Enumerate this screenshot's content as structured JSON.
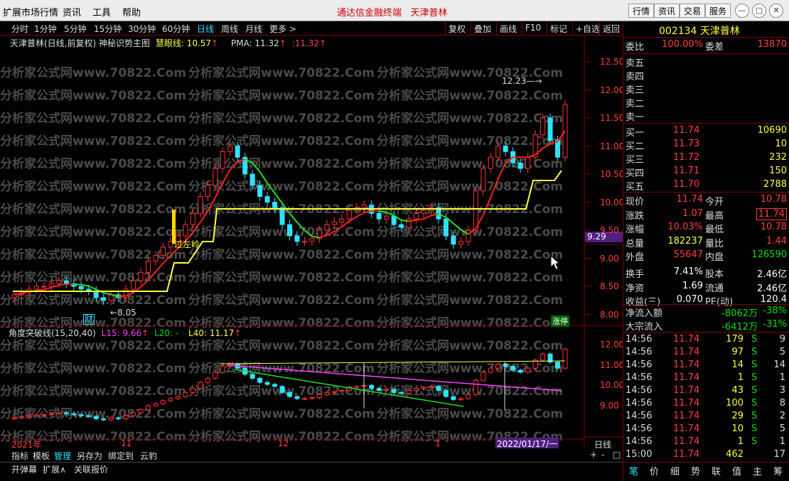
{
  "menubar": {
    "items": [
      "扩展市场行情",
      "资讯",
      "工具",
      "帮助"
    ],
    "brand": "通达信金融终端",
    "stock_title": "天津普林",
    "right_buttons": [
      "行情",
      "资讯",
      "交易",
      "服务"
    ],
    "window_icons": [
      "minimize-icon",
      "restore-icon",
      "close-icon"
    ]
  },
  "periods": {
    "items": [
      "分时",
      "1分钟",
      "5分钟",
      "15分钟",
      "30分钟",
      "60分钟",
      "日线",
      "周线",
      "月线",
      "更多 >"
    ],
    "active": "日线",
    "tools": [
      "复权",
      "叠加",
      "画线",
      "F10",
      "标记",
      "+自选",
      "返回"
    ]
  },
  "chart": {
    "header": "天津普林(日线,前复权) 神秘识势主图",
    "hyx_label": "慧眼线: 10.57",
    "pma_label": "PMA: 11.32",
    "pma_val2": "11.32",
    "annot_high": "12.23",
    "annot_low": "8.05",
    "annot_cai": "财",
    "annot_guozuoling": "过左岭",
    "annot_zhangting": "涨停",
    "price_marker": "9.29",
    "y_axis_main": [
      "12.50",
      "12.00",
      "11.50",
      "11.00",
      "10.50",
      "10.00",
      "9.50",
      "9.00",
      "8.50",
      "8.00"
    ],
    "indicator_title": "角度突破线(15,20,40)",
    "l15": "L15: 9.66",
    "l20": "L20: -",
    "l40": "L40: 11.17",
    "y_axis_ind": [
      "12.00",
      "11.00",
      "10.00",
      "9.00"
    ],
    "x_labels": [
      "2021年",
      "11",
      "12",
      "1"
    ],
    "date_box": "2022/01/17/一",
    "period_box": "日线",
    "zoom_buttons": [
      "+",
      "-",
      "□"
    ]
  },
  "watermark": "分析家公式网www.70822.Com",
  "bottombar": {
    "items": [
      "指标",
      "模板",
      "管理",
      "另存为",
      "绑定到",
      "云豹"
    ],
    "active": "管理"
  },
  "statusbar": {
    "items": [
      "开弹幕",
      "扩展∧",
      "关联报价"
    ]
  },
  "quote": {
    "code": "002134",
    "name": "天津普林",
    "weibi_label": "委比",
    "weibi": "100.00%",
    "weicha_label": "委差",
    "weicha": "13870",
    "sell": [
      {
        "label": "卖五"
      },
      {
        "label": "卖四"
      },
      {
        "label": "卖三"
      },
      {
        "label": "卖二"
      },
      {
        "label": "卖一"
      }
    ],
    "buy": [
      {
        "label": "买一",
        "price": "11.74",
        "vol": "10690"
      },
      {
        "label": "买二",
        "price": "11.73",
        "vol": "10"
      },
      {
        "label": "买三",
        "price": "11.72",
        "vol": "232"
      },
      {
        "label": "买四",
        "price": "11.71",
        "vol": "150"
      },
      {
        "label": "买五",
        "price": "11.70",
        "vol": "2788"
      }
    ],
    "stats": [
      {
        "k": "现价",
        "v": "11.74",
        "vc": "red",
        "k2": "今开",
        "v2": "10.78",
        "v2c": "red"
      },
      {
        "k": "涨跌",
        "v": "1.07",
        "vc": "red",
        "k2": "最高",
        "v2": "11.74",
        "v2c": "red"
      },
      {
        "k": "涨幅",
        "v": "10.03%",
        "vc": "red",
        "k2": "最低",
        "v2": "10.78",
        "v2c": "red"
      },
      {
        "k": "总量",
        "v": "182237",
        "vc": "yellow",
        "k2": "量比",
        "v2": "1.44",
        "v2c": "red"
      },
      {
        "k": "外盘",
        "v": "55647",
        "vc": "red",
        "k2": "内盘",
        "v2": "126590",
        "v2c": "green"
      },
      {
        "k": "换手",
        "v": "7.41%",
        "vc": "white",
        "k2": "股本",
        "v2": "2.46亿",
        "v2c": "white"
      },
      {
        "k": "净资",
        "v": "1.69",
        "vc": "white",
        "k2": "流通",
        "v2": "2.46亿",
        "v2c": "white"
      },
      {
        "k": "收益(三)",
        "v": "0.070",
        "vc": "white",
        "k2": "PE(动)",
        "v2": "120.4",
        "v2c": "white"
      }
    ],
    "flows": [
      {
        "k": "净流入额",
        "v": "-8062万",
        "p": "-38%"
      },
      {
        "k": "大宗流入",
        "v": "-6412万",
        "p": "-31%"
      }
    ],
    "ticks": [
      {
        "t": "14:56",
        "p": "11.74",
        "v": "179",
        "s": "S",
        "n": "9"
      },
      {
        "t": "14:56",
        "p": "11.74",
        "v": "97",
        "s": "S",
        "n": "5"
      },
      {
        "t": "14:56",
        "p": "11.74",
        "v": "14",
        "s": "S",
        "n": "14"
      },
      {
        "t": "14:56",
        "p": "11.74",
        "v": "1",
        "s": "S",
        "n": "1"
      },
      {
        "t": "14:56",
        "p": "11.74",
        "v": "43",
        "s": "S",
        "n": "3"
      },
      {
        "t": "14:56",
        "p": "11.74",
        "v": "100",
        "s": "S",
        "n": "8"
      },
      {
        "t": "14:56",
        "p": "11.74",
        "v": "29",
        "s": "S",
        "n": "2"
      },
      {
        "t": "14:56",
        "p": "11.74",
        "v": "10",
        "s": "S",
        "n": "5"
      },
      {
        "t": "14:56",
        "p": "11.74",
        "v": "1",
        "s": "S",
        "n": "1"
      },
      {
        "t": "15:00",
        "p": "11.74",
        "v": "462",
        "s": "",
        "n": "17"
      }
    ],
    "tabs": [
      "笔",
      "价",
      "细",
      "势",
      "联",
      "值",
      "主",
      "筹"
    ],
    "active_tab": "笔"
  }
}
